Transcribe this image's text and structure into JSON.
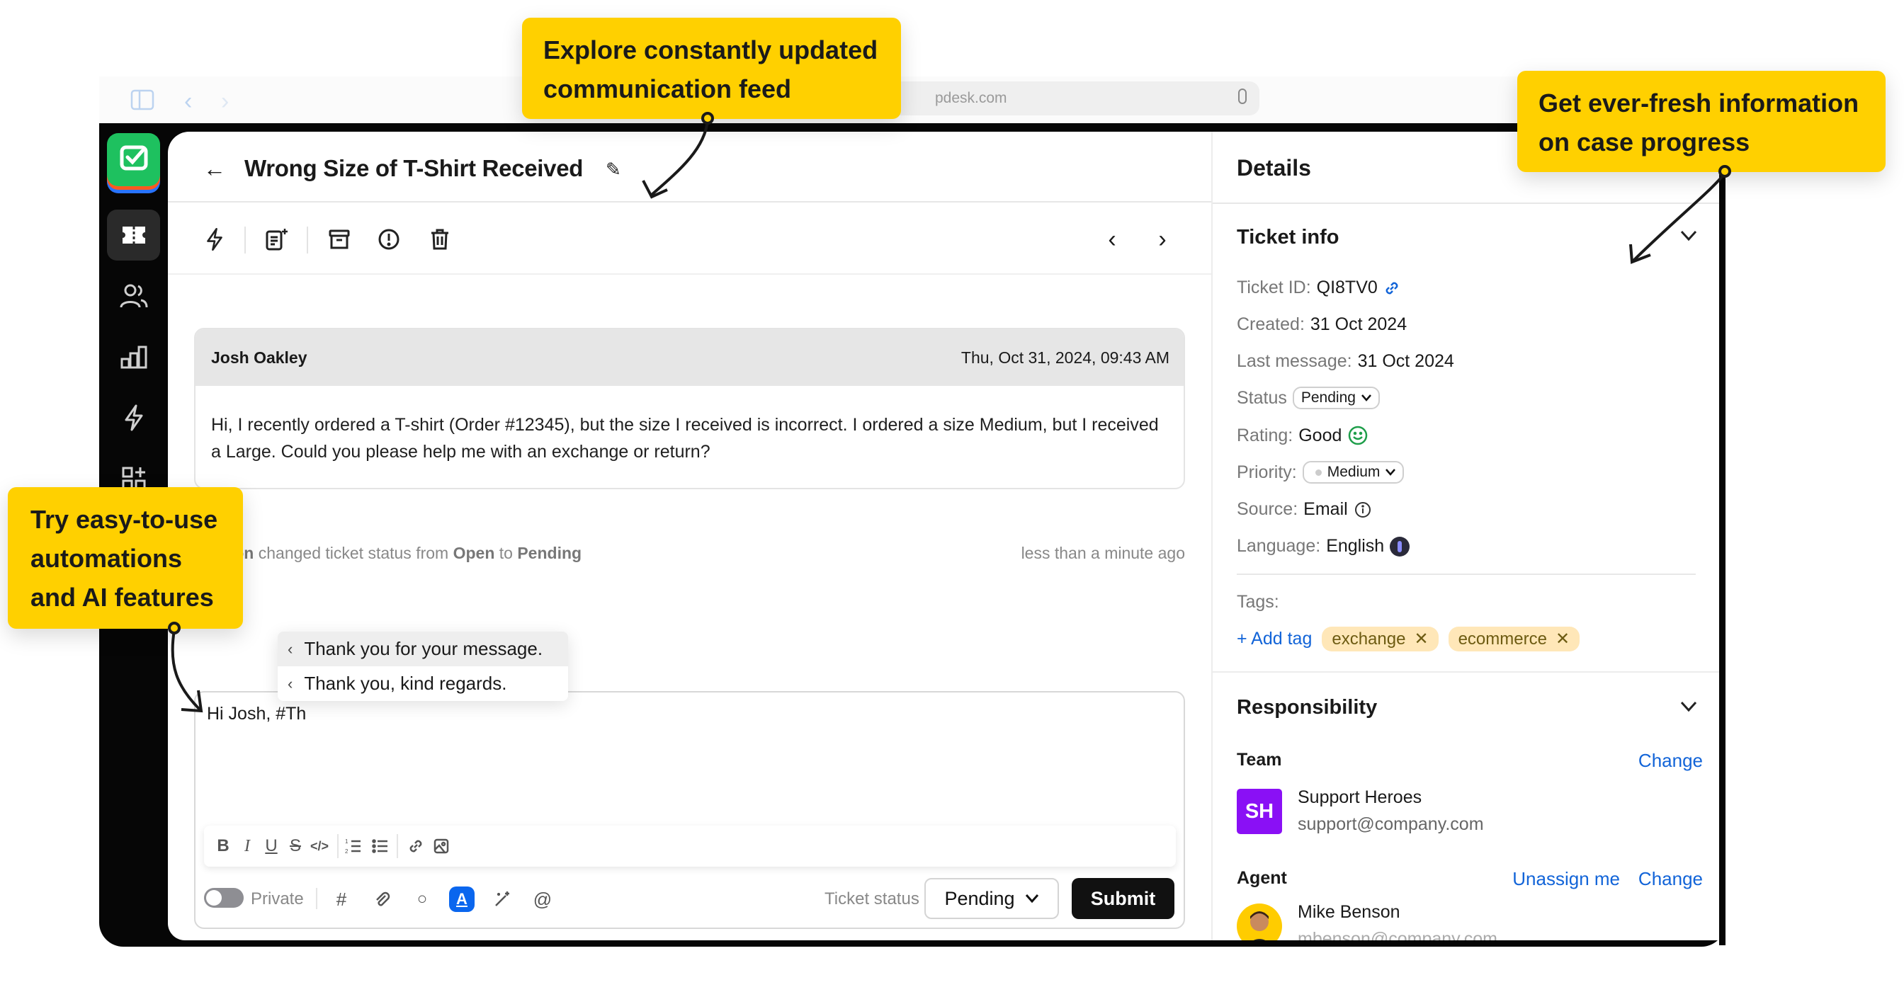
{
  "browser": {
    "address": "pdesk.com"
  },
  "sidebar": {
    "items": [
      {
        "name": "tickets",
        "active": true
      },
      {
        "name": "contacts",
        "active": false
      },
      {
        "name": "reports",
        "active": false
      },
      {
        "name": "automations",
        "active": false
      },
      {
        "name": "apps",
        "active": false
      }
    ]
  },
  "ticket": {
    "title": "Wrong Size of T-Shirt Received"
  },
  "message": {
    "author": "Josh Oakley",
    "timestamp": "Thu, Oct 31, 2024, 09:43 AM",
    "body": "Hi, I recently ordered a T-shirt (Order #12345), but the size I received is incorrect. I ordered a size Medium, but I received a Large. Could you please help me with an exchange or return?"
  },
  "event": {
    "actor": "Benson",
    "text_1": " changed ticket status from ",
    "from": "Open",
    "text_2": " to ",
    "to": "Pending",
    "time": "less than a minute ago"
  },
  "suggestions": [
    "Thank you for your message.",
    "Thank you, kind regards."
  ],
  "composer": {
    "value": "Hi Josh, #Th",
    "private_label": "Private",
    "ticket_status_label": "Ticket status",
    "ticket_status_value": "Pending",
    "submit_label": "Submit"
  },
  "details": {
    "title": "Details",
    "ticket_info": {
      "title": "Ticket info",
      "ticket_id_label": "Ticket ID:",
      "ticket_id": "QI8TV0",
      "created_label": "Created:",
      "created": "31 Oct 2024",
      "last_message_label": "Last message:",
      "last_message": "31 Oct 2024",
      "status_label": "Status",
      "status": "Pending",
      "rating_label": "Rating:",
      "rating": "Good",
      "priority_label": "Priority:",
      "priority": "Medium",
      "source_label": "Source:",
      "source": "Email",
      "language_label": "Language:",
      "language": "English",
      "tags_label": "Tags:",
      "add_tag": "+ Add tag",
      "tags": [
        "exchange",
        "ecommerce"
      ]
    },
    "responsibility": {
      "title": "Responsibility",
      "team_label": "Team",
      "team_change": "Change",
      "team_initials": "SH",
      "team_name": "Support Heroes",
      "team_email": "support@company.com",
      "agent_label": "Agent",
      "unassign": "Unassign me",
      "agent_change": "Change",
      "agent_name": "Mike Benson",
      "agent_email": "mbenson@company.com"
    }
  },
  "callouts": {
    "feed": [
      "Explore constantly updated",
      "communication feed"
    ],
    "progress": [
      "Get ever-fresh information",
      "on case progress"
    ],
    "automations": [
      "Try easy-to-use",
      "automations",
      "and AI features"
    ]
  },
  "colors": {
    "callout": "#ffd000",
    "brand_green": "#1ec15f",
    "link_blue": "#1264d8",
    "team_avatar": "#8a10f5",
    "tag_bg": "#ffe7b8"
  }
}
